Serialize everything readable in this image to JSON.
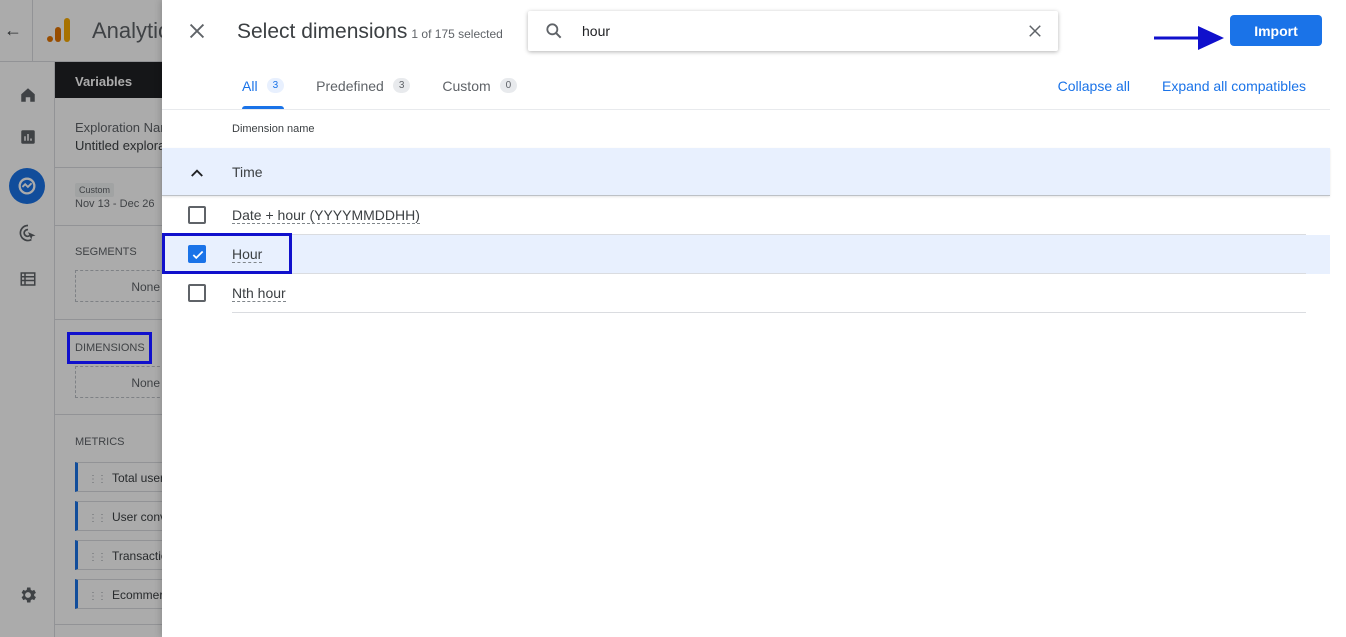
{
  "background_app": {
    "app_name": "Analytics",
    "variables_header": "Variables",
    "exploration_name_label": "Exploration Name",
    "exploration_name_value": "Untitled exploration",
    "date_chip": "Custom",
    "date_range": "Nov 13 - Dec 26",
    "segments_label": "SEGMENTS",
    "segments_placeholder": "None",
    "dimensions_label": "DIMENSIONS",
    "dimensions_placeholder": "None",
    "metrics_label": "METRICS",
    "metrics": [
      "Total users",
      "User conversion",
      "Transactions",
      "Ecommerce"
    ]
  },
  "dialog": {
    "title": "Select dimensions",
    "selection_count": "1 of 175 selected",
    "search": {
      "value": "hour",
      "placeholder": "Search"
    },
    "import_label": "Import",
    "tabs": [
      {
        "label": "All",
        "count": "3",
        "active": true
      },
      {
        "label": "Predefined",
        "count": "3",
        "active": false
      },
      {
        "label": "Custom",
        "count": "0",
        "active": false
      }
    ],
    "collapse_all": "Collapse all",
    "expand_all": "Expand all compatibles",
    "column_header": "Dimension name",
    "group": {
      "label": "Time",
      "expanded": true
    },
    "rows": [
      {
        "label": "Date + hour (YYYYMMDDHH)",
        "checked": false
      },
      {
        "label": "Hour",
        "checked": true
      },
      {
        "label": "Nth hour",
        "checked": false
      }
    ]
  },
  "colors": {
    "accent": "#1a73e8",
    "annotation": "#1010cc",
    "selected_row": "#e8f0fe"
  }
}
